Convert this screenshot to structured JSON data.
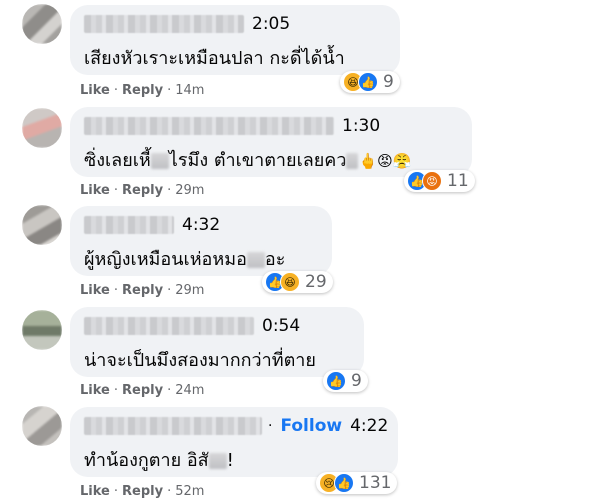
{
  "comments": [
    {
      "timestamp": "2:05",
      "text": "เสียงหัวเราะเหมือนปลา กะดี่ได้น้ำ",
      "reaction_icons": [
        "haha",
        "like"
      ],
      "reaction_count": "9",
      "like_label": "Like",
      "reply_label": "Reply",
      "age": "14m"
    },
    {
      "timestamp": "1:30",
      "text_before": "ซิ่งเลยเหี้",
      "text_after": "ไรมึง ตำเขาตายเลยคว",
      "trailing_emoji": "🖕😡😤",
      "reaction_icons": [
        "like",
        "angry"
      ],
      "reaction_count": "11",
      "like_label": "Like",
      "reply_label": "Reply",
      "age": "29m"
    },
    {
      "timestamp": "4:32",
      "text_before": "ผู้หญิงเหมือนเห่อหมอ",
      "text_after": "อะ",
      "reaction_icons": [
        "like",
        "haha"
      ],
      "reaction_count": "29",
      "like_label": "Like",
      "reply_label": "Reply",
      "age": "29m"
    },
    {
      "timestamp": "0:54",
      "text": "น่าจะเป็นมึงสองมากกว่าที่ตาย",
      "reaction_icons": [
        "like"
      ],
      "reaction_count": "9",
      "like_label": "Like",
      "reply_label": "Reply",
      "age": "24m"
    },
    {
      "follow_label": "Follow",
      "timestamp": "4:22",
      "text_before": "ทำน้องกูตาย อิสั",
      "text_after": "!",
      "reaction_icons": [
        "sad",
        "like"
      ],
      "reaction_count": "131",
      "like_label": "Like",
      "reply_label": "Reply",
      "age": "52m"
    }
  ],
  "colors": {
    "bubble": "#f0f2f5",
    "link_blue": "#1877f2",
    "meta_gray": "#65676b"
  }
}
